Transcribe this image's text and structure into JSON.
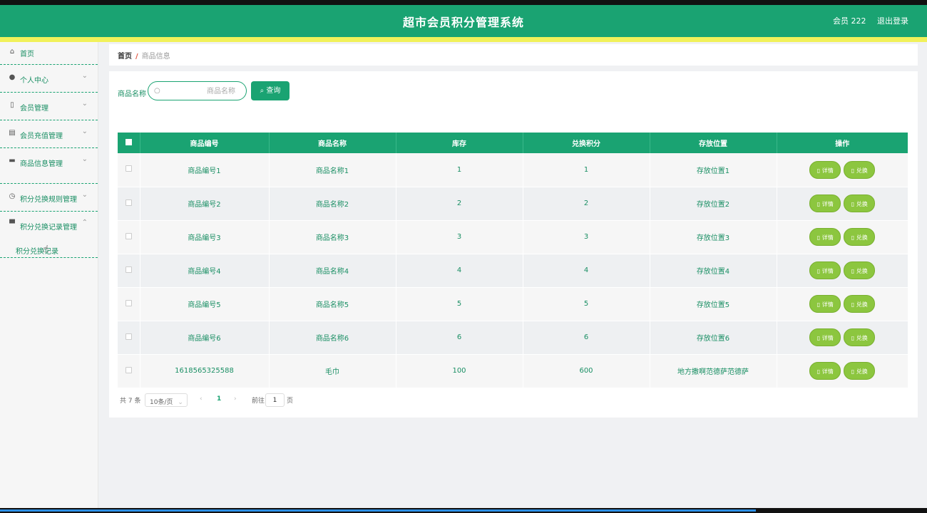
{
  "header": {
    "title": "超市会员积分管理系统",
    "user": "会员 222",
    "logout": "退出登录"
  },
  "sidebar": {
    "items": [
      {
        "label": "首页",
        "icon": "home-icon",
        "chevron": ""
      },
      {
        "label": "个人中心",
        "icon": "user-icon",
        "chevron": "⌄"
      },
      {
        "label": "会员管理",
        "icon": "member-icon",
        "chevron": "⌄"
      },
      {
        "label": "会员充值管理",
        "icon": "clipboard-icon",
        "chevron": "⌄"
      },
      {
        "label": "商品信息管理",
        "icon": "box-icon",
        "chevron": "⌄"
      },
      {
        "label": "积分兑换规则管理",
        "icon": "clock-icon",
        "chevron": "⌄"
      },
      {
        "label": "积分兑换记录管理",
        "icon": "message-icon",
        "chevron": "⌃"
      }
    ],
    "submenu": "积分兑换记录"
  },
  "breadcrumb": {
    "home": "首页",
    "sep": "/",
    "current": "商品信息"
  },
  "search": {
    "label": "商品名称",
    "placeholder": "商品名称",
    "button": "查询"
  },
  "table": {
    "headers": [
      "商品编号",
      "商品名称",
      "库存",
      "兑换积分",
      "存放位置",
      "操作"
    ],
    "rows": [
      [
        "商品编号1",
        "商品名称1",
        "1",
        "1",
        "存放位置1"
      ],
      [
        "商品编号2",
        "商品名称2",
        "2",
        "2",
        "存放位置2"
      ],
      [
        "商品编号3",
        "商品名称3",
        "3",
        "3",
        "存放位置3"
      ],
      [
        "商品编号4",
        "商品名称4",
        "4",
        "4",
        "存放位置4"
      ],
      [
        "商品编号5",
        "商品名称5",
        "5",
        "5",
        "存放位置5"
      ],
      [
        "商品编号6",
        "商品名称6",
        "6",
        "6",
        "存放位置6"
      ],
      [
        "1618565325588",
        "毛巾",
        "100",
        "600",
        "地方撒啊范德萨范德萨"
      ]
    ],
    "actions": {
      "detail": "详情",
      "exchange": "兑换"
    }
  },
  "pager": {
    "total": "共 7 条",
    "size": "10条/页",
    "prev": "‹",
    "page": "1",
    "next": "›",
    "goto": "前往",
    "current": "1",
    "unit": "页"
  },
  "colors": {
    "primary": "#1aa372",
    "accent": "#f1f15a",
    "button": "#8cc63f"
  }
}
